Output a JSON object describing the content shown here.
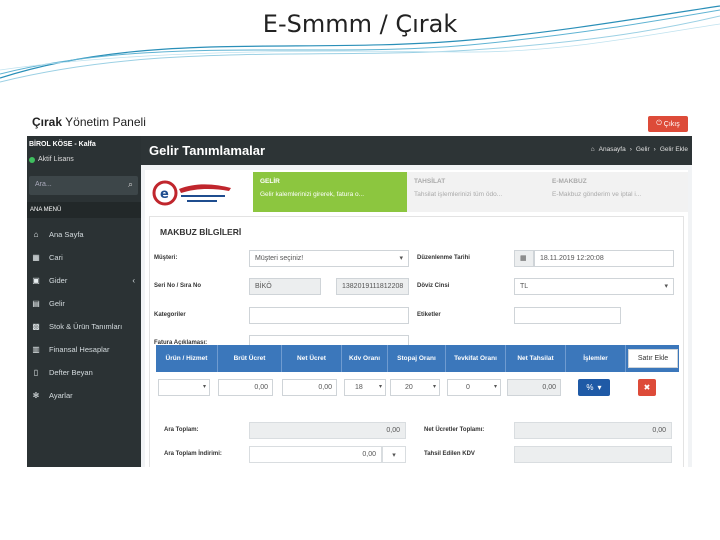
{
  "slide": {
    "title": "E-Smmm / Çırak"
  },
  "app": {
    "brand_bold": "Çırak",
    "brand_rest": " Yönetim Paneli",
    "logout_label": "Çıkış"
  },
  "sidebar": {
    "user": "BİROL KÖSE - Kalfa",
    "license": "Aktif Lisans",
    "search_placeholder": "Ara...",
    "menu_header": "ANA MENÜ",
    "items": [
      {
        "label": "Ana Sayfa",
        "icon": "home-icon"
      },
      {
        "label": "Cari",
        "icon": "table-icon"
      },
      {
        "label": "Gider",
        "icon": "money-icon"
      },
      {
        "label": "Gelir",
        "icon": "card-icon"
      },
      {
        "label": "Stok & Ürün Tanımları",
        "icon": "box-icon"
      },
      {
        "label": "Finansal Hesaplar",
        "icon": "calculator-icon"
      },
      {
        "label": "Defter Beyan",
        "icon": "book-icon"
      },
      {
        "label": "Ayarlar",
        "icon": "gear-icon"
      }
    ]
  },
  "header": {
    "title": "Gelir Tanımlamalar",
    "breadcrumb": [
      "Anasayfa",
      "Gelir",
      "Gelir Ekle"
    ]
  },
  "steps": [
    {
      "title": "GELİR",
      "desc": "Gelir kalemlerinizi girerek, fatura o..."
    },
    {
      "title": "TAHSİLAT",
      "desc": "Tahsilat işlemlerinizi tüm ödo..."
    },
    {
      "title": "E-MAKBUZ",
      "desc": "E-Makbuz gönderim ve iptal i..."
    }
  ],
  "form": {
    "section_title": "MAKBUZ BİLGİLERİ",
    "customer_label": "Müşteri:",
    "customer_placeholder": "Müşteri seçiniz!",
    "edit_date_label": "Düzenlenme Tarihi",
    "edit_date_value": "18.11.2019 12:20:08",
    "serial_label": "Seri No / Sıra No",
    "serial_value": "BİKÖ",
    "sequence_value": "1382019111812208",
    "currency_label": "Döviz Cinsi",
    "currency_value": "TL",
    "categories_label": "Kategoriler",
    "tags_label": "Etiketler",
    "note_label": "Fatura Açıklaması:"
  },
  "table": {
    "headers": [
      "Ürün / Hizmet",
      "Brüt Ücret",
      "Net Ücret",
      "Kdv Oranı",
      "Stopaj Oranı",
      "Tevkifat Oranı",
      "Net Tahsilat",
      "İşlemler"
    ],
    "add_row_label": "Satır Ekle",
    "row": {
      "gross": "0,00",
      "net": "0,00",
      "vat": "18",
      "withholding": "20",
      "tevkifat": "0",
      "net_collection": "0,00",
      "action_symbol": "%",
      "delete_symbol": "✖"
    }
  },
  "totals": {
    "subtotal_label": "Ara Toplam:",
    "subtotal_value": "0,00",
    "net_total_label": "Net Ücretler Toplamı:",
    "net_total_value": "0,00",
    "discount_label": "Ara Toplam İndirimi:",
    "discount_value": "0,00",
    "vat_collected_label": "Tahsil Edilen KDV"
  },
  "colors": {
    "accent_green": "#8cc63f",
    "table_blue": "#3b77bb",
    "danger": "#dd4b39",
    "sidebar_bg": "#2b3234"
  }
}
